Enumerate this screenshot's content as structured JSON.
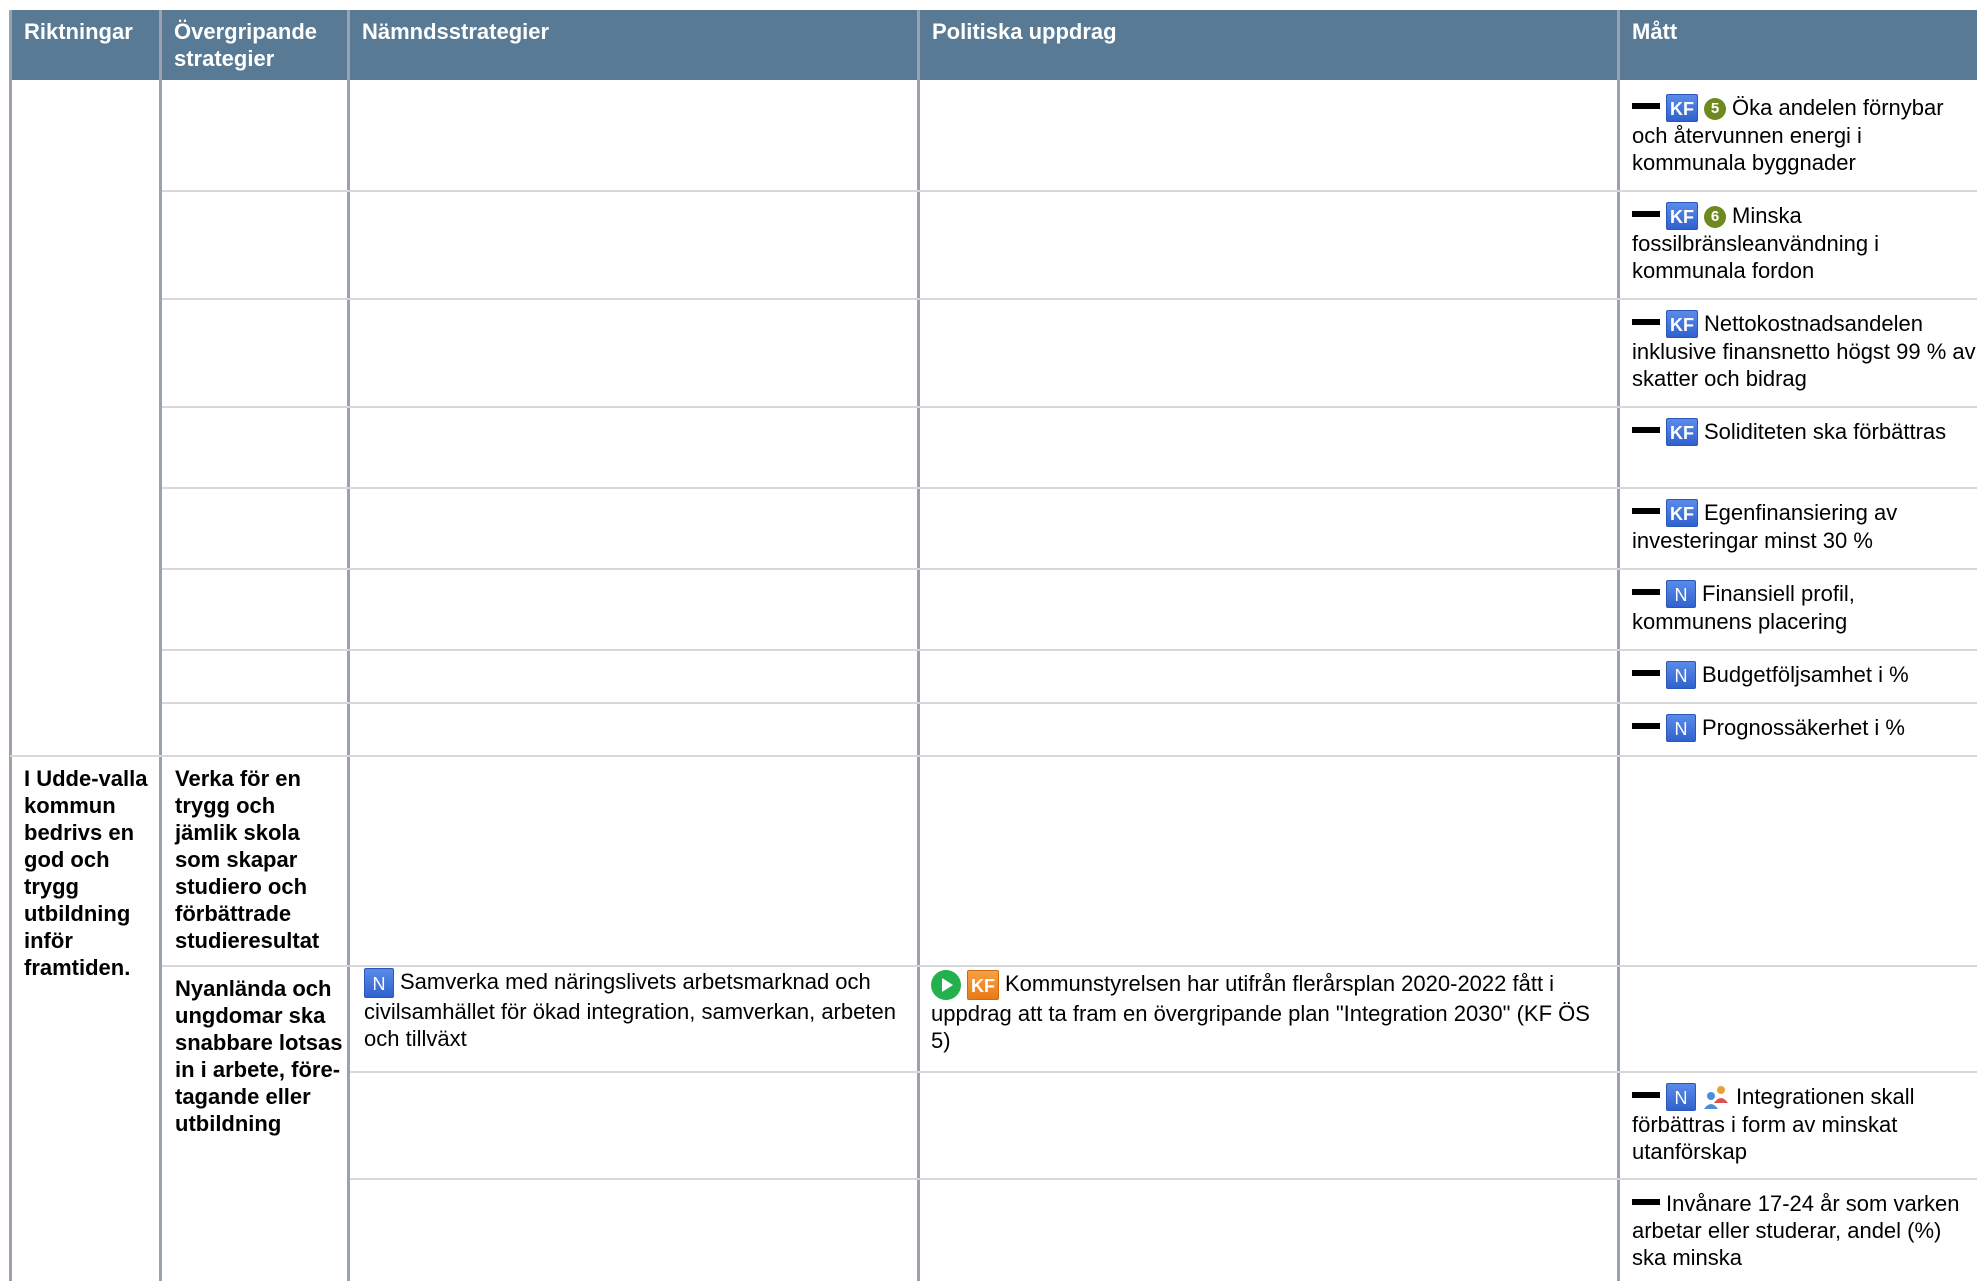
{
  "headers": [
    "Riktningar",
    "Övergripande strategier",
    "Nämndsstrategier",
    "Politiska uppdrag",
    "Mått"
  ],
  "measures": [
    {
      "tags": [
        "KF",
        "5"
      ],
      "text": "Öka andelen förnybar och återvunnen energi i kommunala byggnader"
    },
    {
      "tags": [
        "KF",
        "6"
      ],
      "text": "Minska fossilbränsleanvändning i kommunala fordon"
    },
    {
      "tags": [
        "KF"
      ],
      "text": "Nettokostnadsandelen inklusive finansnetto högst 99 % av skatter och bidrag"
    },
    {
      "tags": [
        "KF"
      ],
      "text": "Soliditeten ska förbättras"
    },
    {
      "tags": [
        "KF"
      ],
      "text": "Egenfinansiering av investeringar minst 30 %"
    },
    {
      "tags": [
        "N"
      ],
      "text": "Finansiell profil, kommunens placering"
    },
    {
      "tags": [
        "N"
      ],
      "text": "Budgetföljsamhet i %"
    },
    {
      "tags": [
        "N"
      ],
      "text": "Prognossäkerhet i %"
    },
    {
      "tags": [
        "N",
        "people"
      ],
      "text": "Integrationen skall förbättras i form av minskat utanförskap"
    },
    {
      "tags": [],
      "text": "Invånare 17-24 år som varken arbetar eller studerar, andel (%) ska minska"
    }
  ],
  "direction": "I Udde-valla kommun bedrivs en god och trygg utbildning inför framtiden.",
  "strategy_1": "Verka för en trygg och jämlik skola som skapar studiero och förbättrade studieresultat",
  "strategy_2": "Nyanlända och ungdomar ska snabbare lotsas in i arbete, före-tagande eller utbildning",
  "board_strategy": {
    "tag": "N",
    "text": "Samverka med näringslivets arbetsmarknad och civilsamhället för ökad integration, samverkan, arbeten och tillväxt"
  },
  "political_assignment": {
    "tag": "KF",
    "text": "Kommunstyrelsen har utifrån flerårsplan 2020-2022 fått i uppdrag att ta fram en övergripande plan \"Integration 2030\" (KF ÖS 5)"
  },
  "badges": {
    "kf": "KF",
    "n": "N"
  },
  "colors": {
    "header_bg": "#587a94",
    "badge_blue": "#3a6ed8",
    "badge_orange": "#f08a25",
    "goal_green": "#6e8a1f",
    "play_green": "#22b14c"
  }
}
